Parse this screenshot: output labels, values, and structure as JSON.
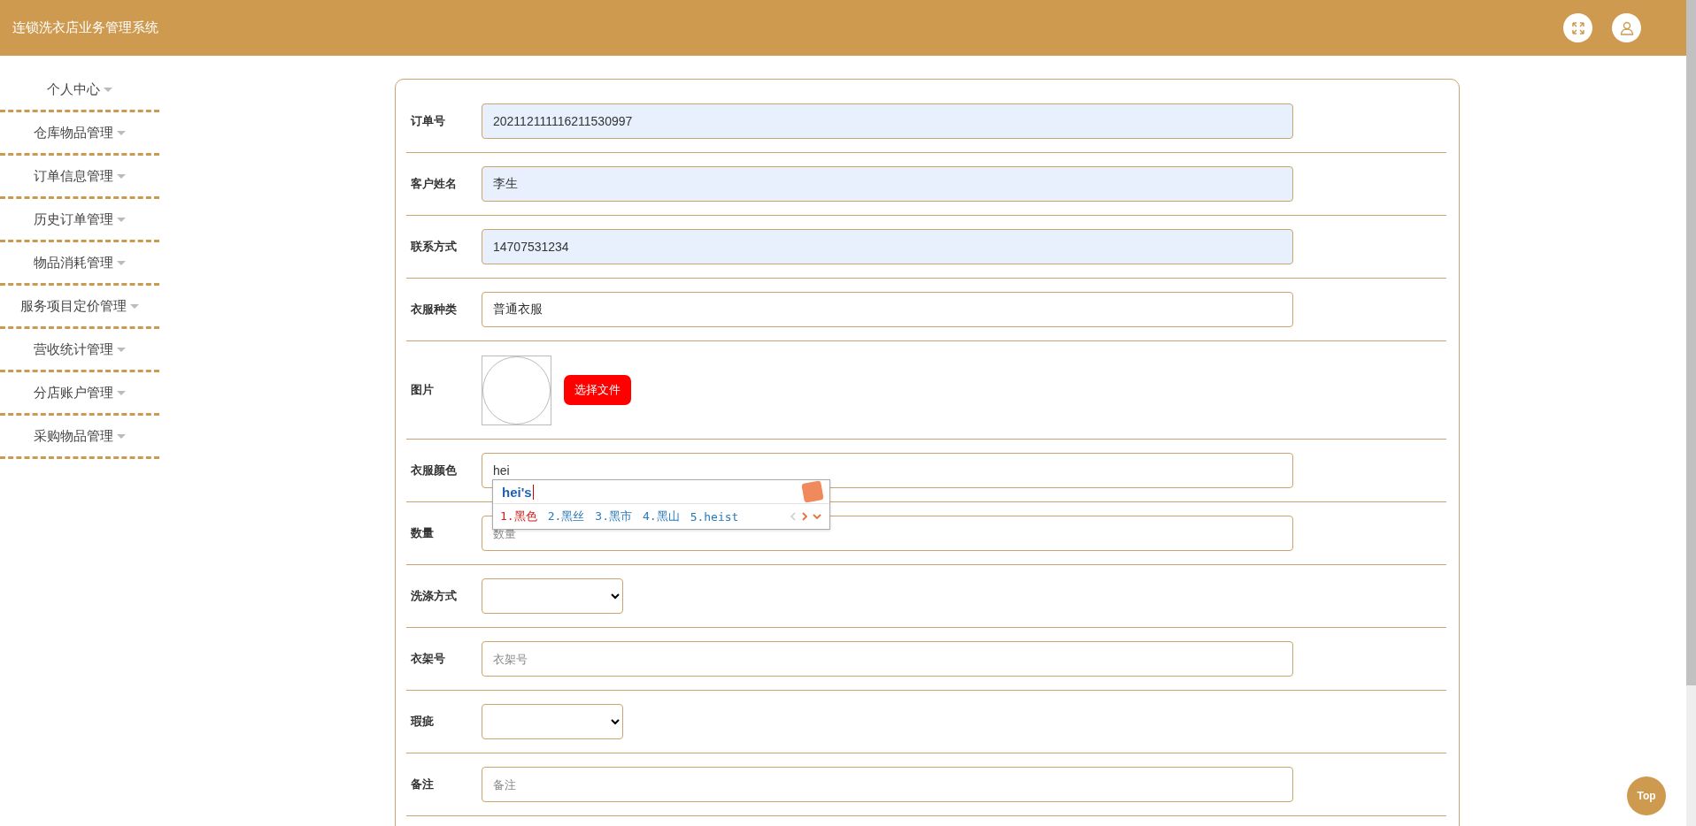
{
  "header": {
    "title": "连锁洗衣店业务管理系统"
  },
  "sidebar": {
    "items": [
      {
        "label": "个人中心"
      },
      {
        "label": "仓库物品管理"
      },
      {
        "label": "订单信息管理"
      },
      {
        "label": "历史订单管理"
      },
      {
        "label": "物品消耗管理"
      },
      {
        "label": "服务项目定价管理"
      },
      {
        "label": "营收统计管理"
      },
      {
        "label": "分店账户管理"
      },
      {
        "label": "采购物品管理"
      }
    ]
  },
  "form": {
    "fields": [
      {
        "kind": "text",
        "label": "订单号",
        "value": "202112111116211530997",
        "autofilled": true
      },
      {
        "kind": "text",
        "label": "客户姓名",
        "value": "李生",
        "autofilled": true
      },
      {
        "kind": "text",
        "label": "联系方式",
        "value": "14707531234",
        "autofilled": true
      },
      {
        "kind": "text",
        "label": "衣服种类",
        "value": "普通衣服",
        "autofilled": false
      },
      {
        "kind": "image",
        "label": "图片",
        "button": "选择文件"
      },
      {
        "kind": "text",
        "label": "衣服颜色",
        "value": "hei",
        "autofilled": false
      },
      {
        "kind": "text",
        "label": "数量",
        "placeholder": "数量",
        "autofilled": false
      },
      {
        "kind": "select",
        "label": "洗涤方式"
      },
      {
        "kind": "text",
        "label": "衣架号",
        "placeholder": "衣架号",
        "autofilled": false
      },
      {
        "kind": "select",
        "label": "瑕疵"
      },
      {
        "kind": "text",
        "label": "备注",
        "placeholder": "备注",
        "autofilled": false
      }
    ]
  },
  "ime_popup": {
    "composition": "hei's",
    "candidates": [
      {
        "label": "1.黑色",
        "selected": true
      },
      {
        "label": "2.黑丝",
        "selected": false
      },
      {
        "label": "3.黑市",
        "selected": false
      },
      {
        "label": "4.黑山",
        "selected": false
      },
      {
        "label": "5.heist",
        "selected": false
      }
    ]
  },
  "back_to_top": "Top"
}
